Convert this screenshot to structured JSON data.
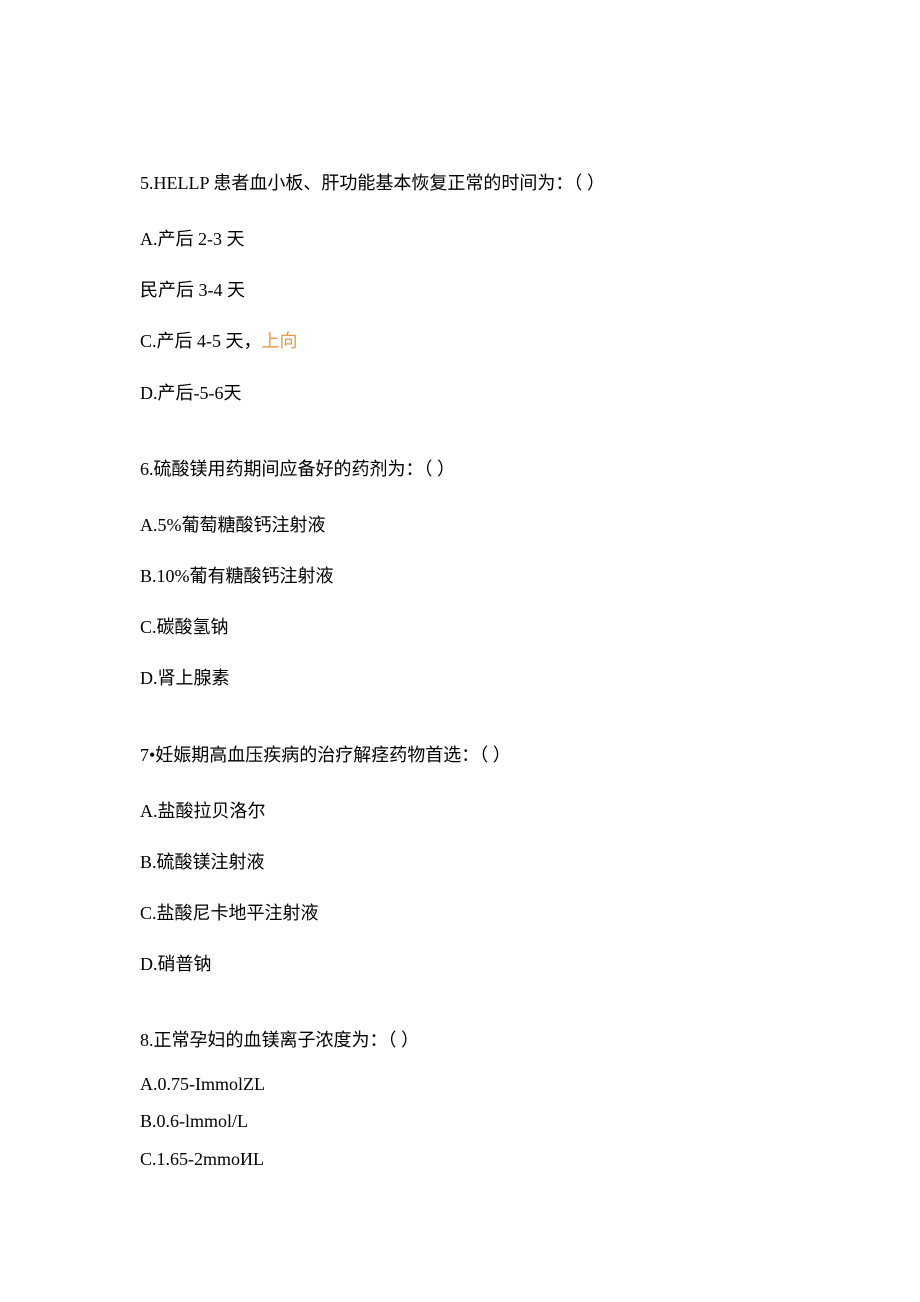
{
  "questions": [
    {
      "stem": "5.HELLP 患者血小板、肝功能基本恢复正常的时间为：（ ）",
      "options": [
        {
          "text_prefix": "A.产后 2-3 天",
          "highlight": ""
        },
        {
          "text_prefix": "民产后 3-4 天",
          "highlight": ""
        },
        {
          "text_prefix": "C.产后 4-5 天，",
          "highlight": "上向"
        },
        {
          "text_prefix": "D.产后-5-6天",
          "highlight": ""
        }
      ]
    },
    {
      "stem": "6.硫酸镁用药期间应备好的药剂为：（ ）",
      "options": [
        {
          "text_prefix": "A.5%葡萄糖酸钙注射液",
          "highlight": ""
        },
        {
          "text_prefix": "B.10%葡有糖酸钙注射液",
          "highlight": ""
        },
        {
          "text_prefix": "C.碳酸氢钠",
          "highlight": ""
        },
        {
          "text_prefix": "D.肾上腺素",
          "highlight": ""
        }
      ]
    },
    {
      "stem": "7•妊娠期高血压疾病的治疗解痉药物首选：（ ）",
      "options": [
        {
          "text_prefix": "A.盐酸拉贝洛尔",
          "highlight": ""
        },
        {
          "text_prefix": "B.硫酸镁注射液",
          "highlight": ""
        },
        {
          "text_prefix": "C.盐酸尼卡地平注射液",
          "highlight": ""
        },
        {
          "text_prefix": "D.硝普钠",
          "highlight": ""
        }
      ]
    },
    {
      "stem": "8.正常孕妇的血镁离子浓度为：（ ）",
      "options": [
        {
          "text_prefix": "A.0.75-ImmolZL",
          "highlight": ""
        },
        {
          "text_prefix": "B.0.6-lmmol/L",
          "highlight": ""
        },
        {
          "text_prefix": "C.1.65-2mmoИL",
          "highlight": ""
        }
      ]
    }
  ]
}
